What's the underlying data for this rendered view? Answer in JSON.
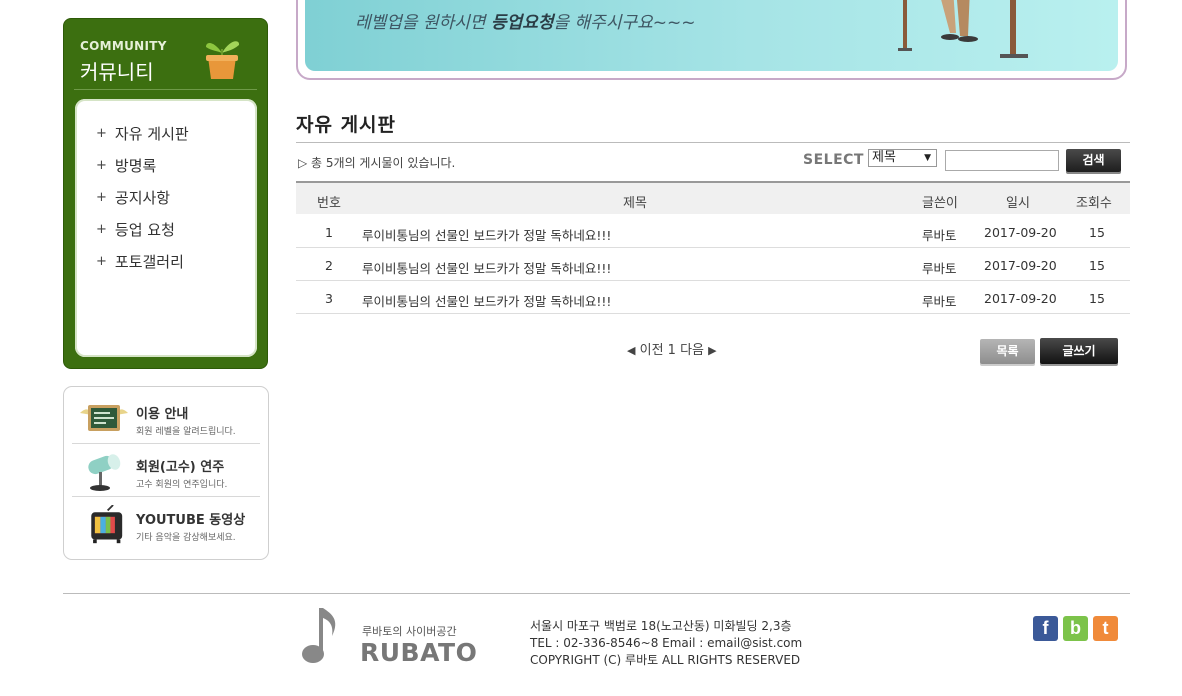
{
  "banner": {
    "line2_prefix": "레벨업을 원하시면 ",
    "line2_bold": "등업요청",
    "line2_suffix": "을 해주시구요~~~"
  },
  "community": {
    "title_en": "COMMUNITY",
    "title_ko": "커뮤니티",
    "bullet": "+",
    "items": [
      {
        "label": "자유 게시판"
      },
      {
        "label": "방명록"
      },
      {
        "label": "공지사항"
      },
      {
        "label": "등업 요청"
      },
      {
        "label": "포토갤러리"
      }
    ]
  },
  "info_box": [
    {
      "title": "이용 안내",
      "desc": "회원 레벨을 알려드립니다.",
      "icon": "chalkboard-icon"
    },
    {
      "title": "회원(고수) 연주",
      "desc": "고수 회원의 연주입니다.",
      "icon": "spotlight-icon"
    },
    {
      "title": "YOUTUBE 동영상",
      "desc": "기타 음악을 감상해보세요.",
      "icon": "tv-icon"
    }
  ],
  "board": {
    "title": "자유 게시판",
    "count_text": "▷ 총 5개의 게시물이 있습니다.",
    "select_label": "SELECT",
    "select_value": "제목",
    "search_button": "검색",
    "search_value": "",
    "columns": {
      "no": "번호",
      "title": "제목",
      "writer": "글쓴이",
      "date": "일시",
      "views": "조회수"
    },
    "rows": [
      {
        "no": "1",
        "title": "루이비통님의 선물인 보드카가 정말 독하네요!!!",
        "writer": "루바토",
        "date": "2017-09-20",
        "views": "15"
      },
      {
        "no": "2",
        "title": "루이비통님의 선물인 보드카가 정말 독하네요!!!",
        "writer": "루바토",
        "date": "2017-09-20",
        "views": "15"
      },
      {
        "no": "3",
        "title": "루이비통님의 선물인 보드카가 정말 독하네요!!!",
        "writer": "루바토",
        "date": "2017-09-20",
        "views": "15"
      }
    ],
    "pager": {
      "prev": "이전",
      "page": "1",
      "next": "다음"
    },
    "list_button": "목록",
    "write_button": "글쓰기"
  },
  "footer": {
    "logo_sub": "루바토의 사이버공간",
    "logo_main": "RUBATO",
    "address": "서울시 마포구 백범로 18(노고산동) 미화빌딩 2,3층",
    "contact": "TEL : 02-336-8546~8 Email : email@sist.com",
    "copyright": "COPYRIGHT (C) 루바토 ALL RIGHTS RESERVED",
    "social": [
      {
        "letter": "f",
        "icon": "facebook-icon",
        "color": "#3b5998"
      },
      {
        "letter": "b",
        "icon": "blog-icon",
        "color": "#7cc34a"
      },
      {
        "letter": "t",
        "icon": "twitter-icon",
        "color": "#f08a3a"
      }
    ]
  },
  "colors": {
    "community_green": "#3c6f10",
    "banner_teal": "#a6e4e6"
  }
}
